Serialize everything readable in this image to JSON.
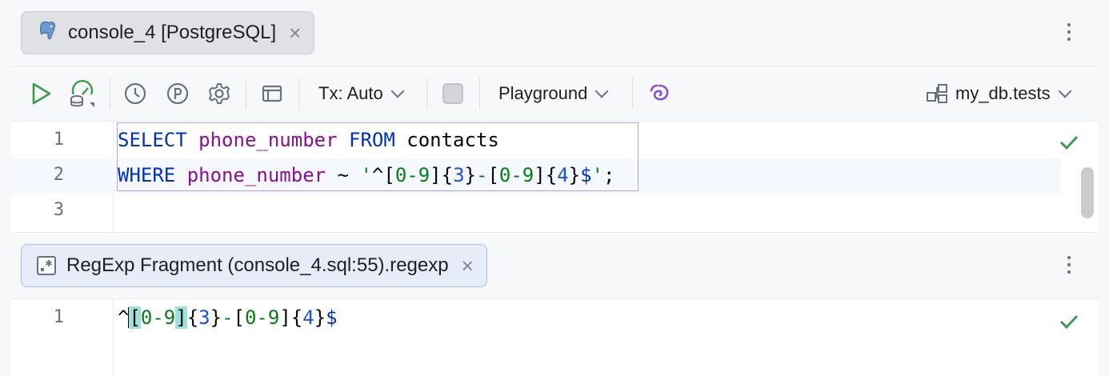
{
  "top_tab": {
    "label": "console_4 [PostgreSQL]",
    "icon": "postgresql-elephant-icon"
  },
  "toolbar": {
    "tx_mode": "Tx: Auto",
    "mode": "Playground",
    "datasource": "my_db.tests"
  },
  "editor": {
    "lines": [
      {
        "number": "1"
      },
      {
        "number": "2"
      },
      {
        "number": "3"
      }
    ],
    "line1": {
      "kw1": "SELECT",
      "col": "phone_number",
      "kw2": "FROM",
      "table": "contacts"
    },
    "line2": {
      "kw": "WHERE",
      "col": "phone_number",
      "op": "~",
      "q1": "'",
      "caret": "^",
      "b1": "[",
      "r1": "0-9",
      "b2": "]",
      "c1": "{",
      "n1": "3",
      "c2": "}",
      "dash": "-",
      "b3": "[",
      "r2": "0-9",
      "b4": "]",
      "c3": "{",
      "n2": "4",
      "c4": "}",
      "dollar": "$",
      "q2": "'",
      "semi": ";"
    }
  },
  "fragment_tab": {
    "label": "RegExp Fragment (console_4.sql:55).regexp",
    "icon": "regexp-file-icon"
  },
  "fragment": {
    "line_number": "1",
    "caret": "^",
    "b1": "[",
    "r1": "0-9",
    "b2": "]",
    "c1": "{",
    "n1": "3",
    "c2": "}",
    "dash": "-",
    "b3": "[",
    "r2": "0-9",
    "b4": "]",
    "c3": "{",
    "n2": "4",
    "c4": "}",
    "dollar": "$"
  },
  "colors": {
    "keyword": "#0033b3",
    "column": "#871094",
    "string": "#067d17",
    "number": "#1750eb",
    "check": "#3d9a50",
    "bracket_highlight": "#9ee0dc"
  }
}
